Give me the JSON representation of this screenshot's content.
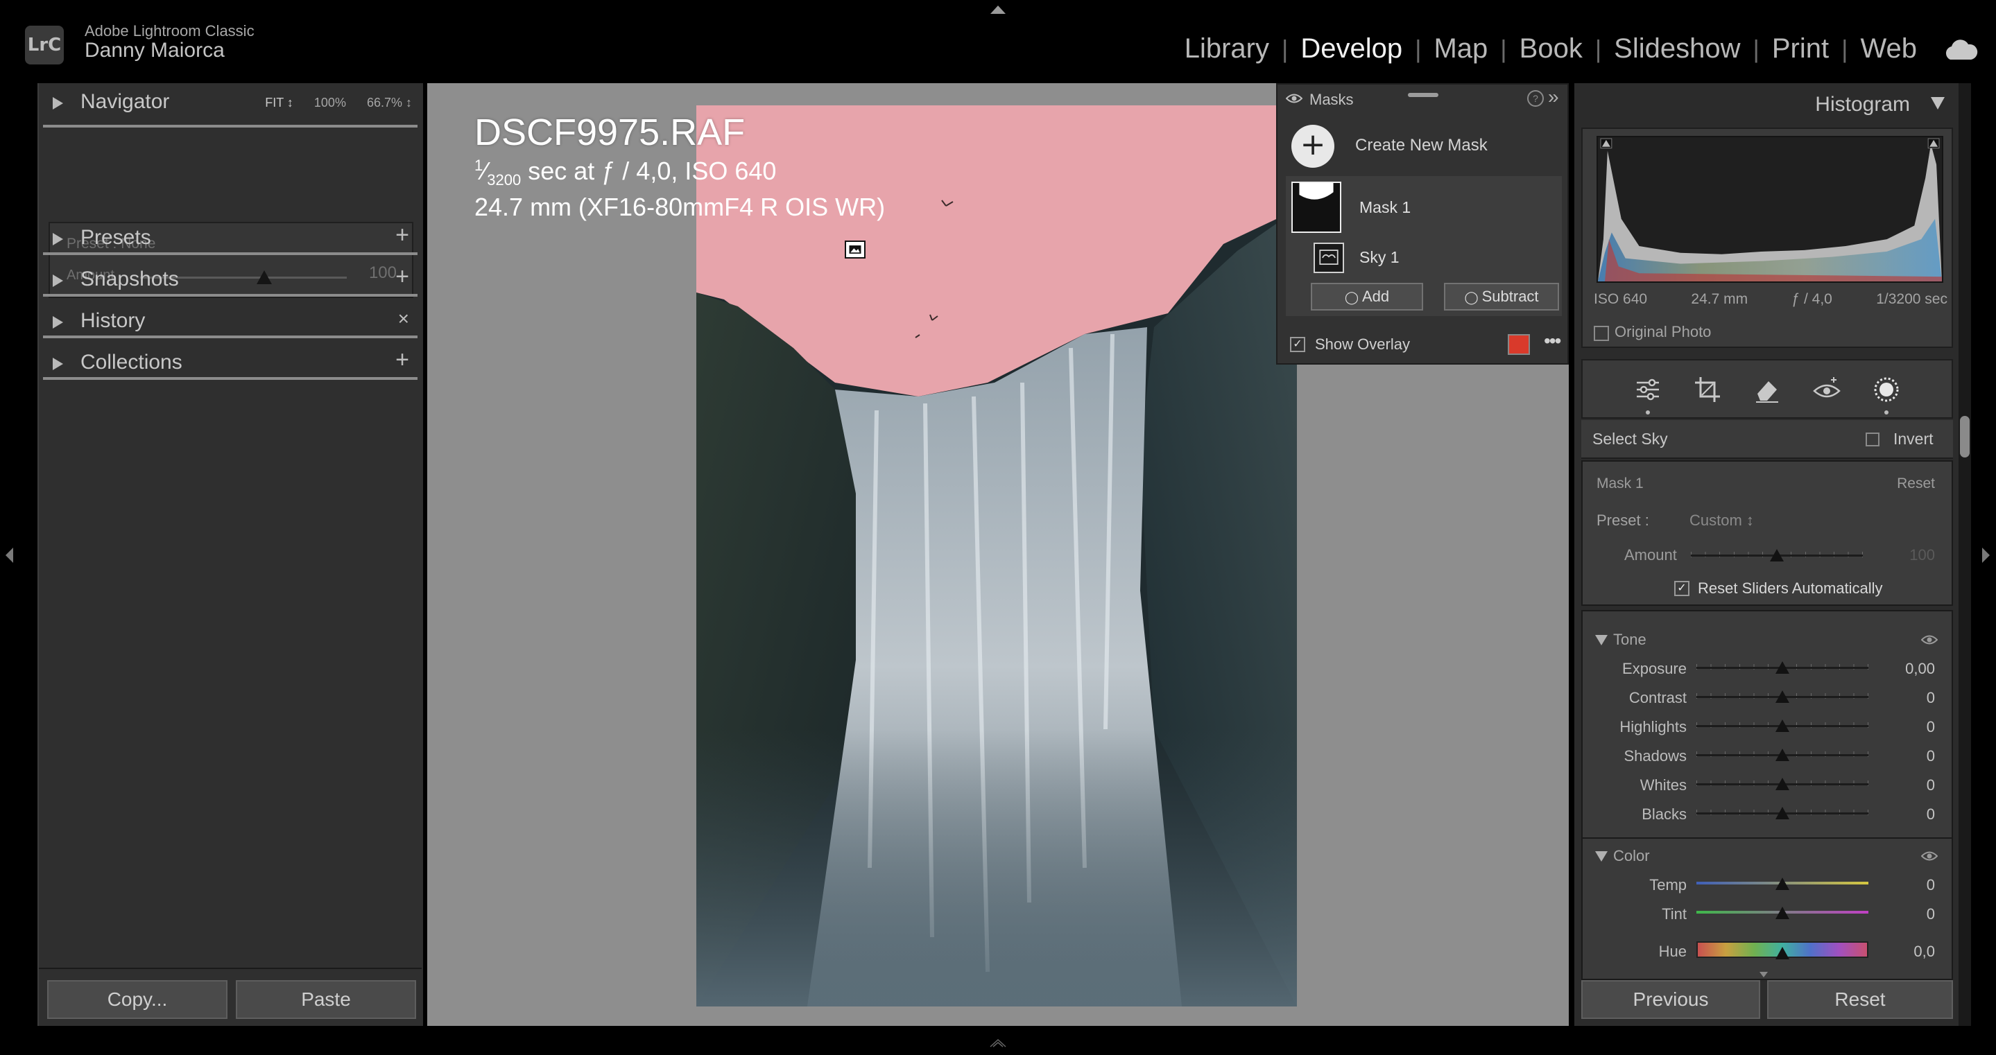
{
  "app": {
    "logo": "LrC",
    "name": "Adobe Lightroom Classic",
    "user": "Danny Maiorca"
  },
  "modules": [
    "Library",
    "Develop",
    "Map",
    "Book",
    "Slideshow",
    "Print",
    "Web"
  ],
  "active_module": "Develop",
  "left_panel": {
    "navigator": {
      "label": "Navigator",
      "zoom_fit": "FIT ↕",
      "zoom_100": "100%",
      "zoom_667": "66.7% ↕"
    },
    "preset": {
      "label": "Preset : None",
      "amount_label": "Amount",
      "amount_value": "100",
      "amount_level": 0.6
    },
    "sections": [
      {
        "label": "Presets",
        "action": "+"
      },
      {
        "label": "Snapshots",
        "action": "+"
      },
      {
        "label": "History",
        "action": "×"
      },
      {
        "label": "Collections",
        "action": "+"
      }
    ],
    "copy_label": "Copy...",
    "paste_label": "Paste"
  },
  "photo_info": {
    "filename": "DSCF9975.RAF",
    "exposure_num": "1",
    "exposure_den": "3200",
    "exposure_rest": " sec at ƒ / 4,0, ISO 640",
    "lens": "24.7 mm (XF16-80mmF4 R OIS WR)"
  },
  "masks_panel": {
    "title": "Masks",
    "help": "?",
    "collapse": "»",
    "create_label": "Create New Mask",
    "create_symbol": "+",
    "mask_name": "Mask 1",
    "component_name": "Sky 1",
    "add_label": "Add",
    "subtract_label": "Subtract",
    "show_overlay_label": "Show Overlay",
    "show_overlay_checked": true,
    "overlay_color": "#d93a2b",
    "more": "•••"
  },
  "histogram": {
    "title": "Histogram",
    "iso": "ISO 640",
    "focal": "24.7 mm",
    "aperture": "ƒ / 4,0",
    "shutter": "1/3200 sec",
    "original_photo_label": "Original Photo"
  },
  "mask_edit": {
    "select_label": "Select Sky",
    "invert_label": "Invert",
    "mask_name": "Mask 1",
    "reset_label": "Reset",
    "preset_label": "Preset :",
    "preset_value": "Custom ↕",
    "amount_label": "Amount",
    "amount_value": "100",
    "reset_sliders_label": "Reset Sliders Automatically",
    "reset_sliders_checked": true
  },
  "tone": {
    "title": "Tone",
    "sliders": [
      {
        "label": "Exposure",
        "value": "0,00"
      },
      {
        "label": "Contrast",
        "value": "0"
      },
      {
        "label": "Highlights",
        "value": "0"
      },
      {
        "label": "Shadows",
        "value": "0"
      },
      {
        "label": "Whites",
        "value": "0"
      },
      {
        "label": "Blacks",
        "value": "0"
      }
    ]
  },
  "color": {
    "title": "Color",
    "sliders": [
      {
        "label": "Temp",
        "value": "0"
      },
      {
        "label": "Tint",
        "value": "0"
      },
      {
        "label": "Hue",
        "value": "0,0"
      }
    ]
  },
  "previous_label": "Previous",
  "reset_label": "Reset"
}
